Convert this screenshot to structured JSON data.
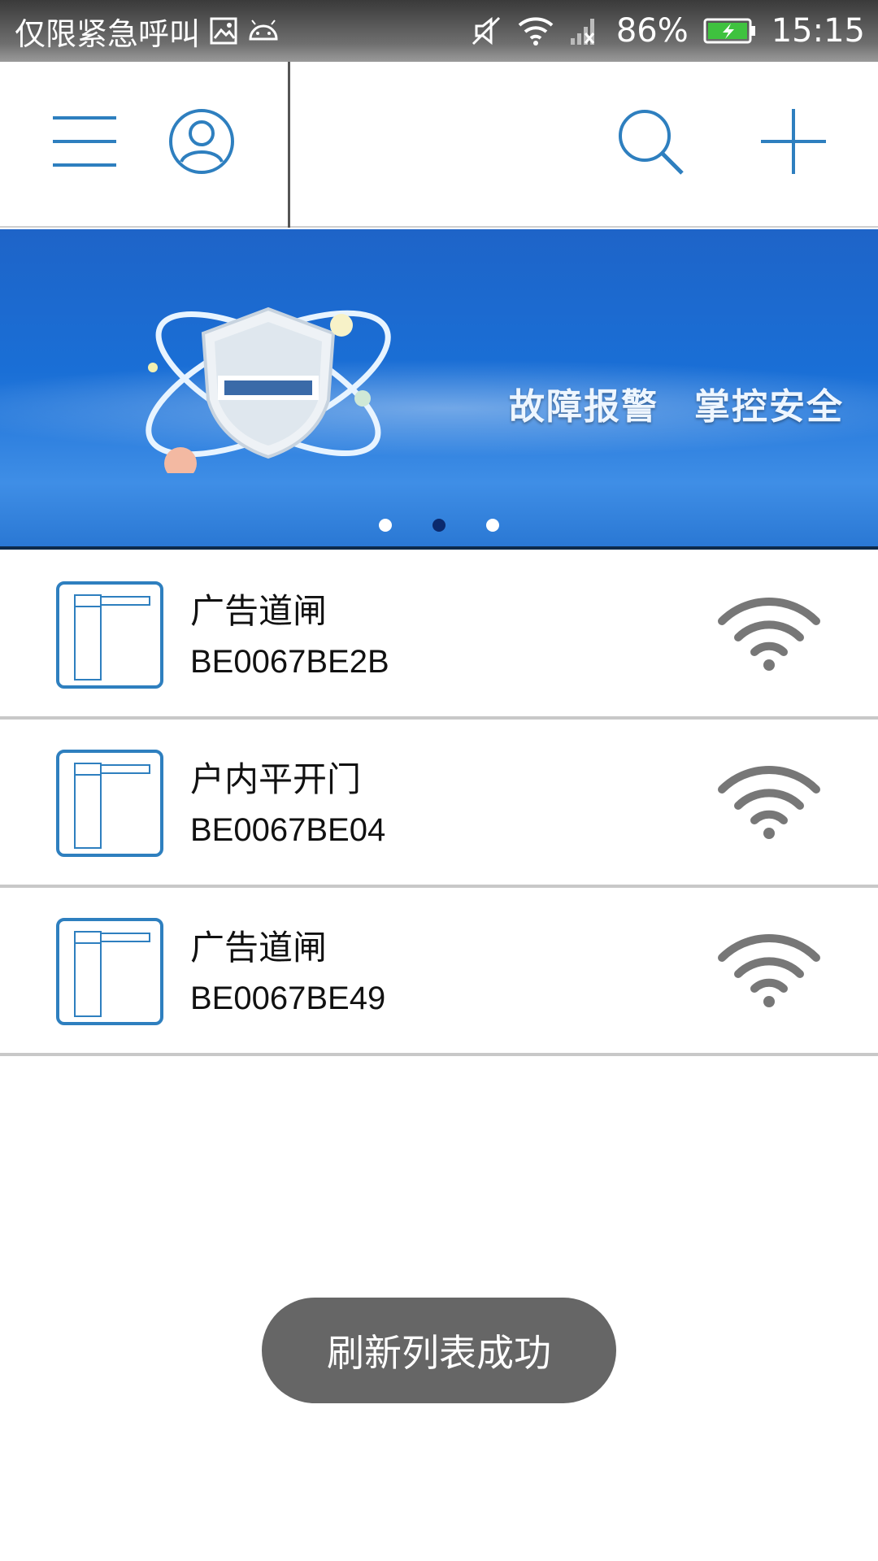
{
  "status_bar": {
    "carrier_text": "仅限紧急呼叫",
    "battery": "86%",
    "time": "15:15"
  },
  "toolbar": {
    "icons": [
      "menu-icon",
      "profile-icon",
      "search-icon",
      "add-icon"
    ]
  },
  "banner": {
    "text_1": "故障报警",
    "text_2": "掌控安全",
    "page_count": 3,
    "active_page": 2
  },
  "devices": [
    {
      "name": "广告道闸",
      "id": "BE0067BE2B"
    },
    {
      "name": "户内平开门",
      "id": "BE0067BE04"
    },
    {
      "name": "广告道闸",
      "id": "BE0067BE49"
    }
  ],
  "toast": {
    "message": "刷新列表成功"
  },
  "colors": {
    "accent": "#2e7fbf",
    "banner_blue": "#1a6fd6",
    "toast_bg": "#666666",
    "divider": "#c8c8c8"
  }
}
